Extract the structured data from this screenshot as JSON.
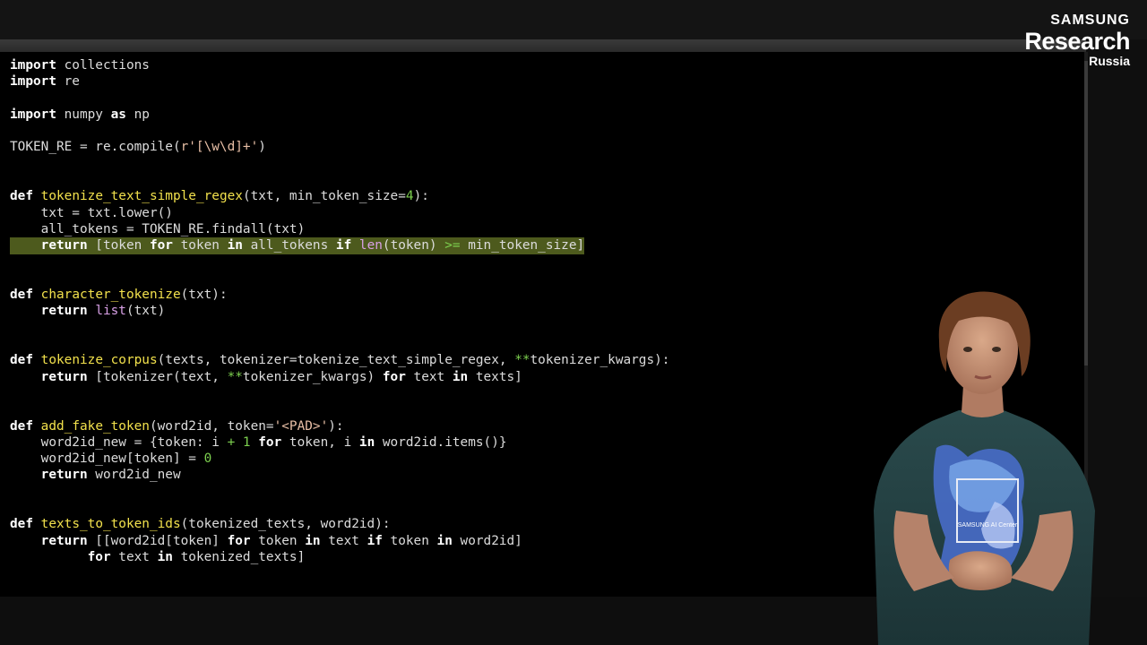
{
  "logo": {
    "line1": "SAMSUNG",
    "line2": "Research",
    "line3": "Russia"
  },
  "shirt_text": "SAMSUNG AI Center",
  "code": {
    "l1": {
      "kw": "import",
      "rest": " collections"
    },
    "l2": {
      "kw": "import",
      "rest": " re"
    },
    "l4": {
      "kw1": "import",
      "mid": " numpy ",
      "kw2": "as",
      "rest": " np"
    },
    "l6": {
      "a": "TOKEN_RE = re.compile(",
      "str": "r'[\\w\\d]+'",
      "b": ")"
    },
    "l9": {
      "kw": "def",
      "fn": "tokenize_text_simple_regex",
      "a": "(txt, min_token_size=",
      "num": "4",
      "b": "):"
    },
    "l10": {
      "a": "    txt = txt.lower()"
    },
    "l11": {
      "a": "    all_tokens = TOKEN_RE.findall(txt)"
    },
    "l12": {
      "kw1": "return",
      "a": " [token ",
      "kw2": "for",
      "b": " token ",
      "kw3": "in",
      "c": " all_tokens ",
      "kw4": "if",
      "sp": " ",
      "bi": "len",
      "d": "(token) ",
      "op": ">=",
      "e": " min_token_size]"
    },
    "l15": {
      "kw": "def",
      "fn": "character_tokenize",
      "a": "(txt):"
    },
    "l16": {
      "kw": "return",
      "sp": " ",
      "bi": "list",
      "a": "(txt)"
    },
    "l19": {
      "kw": "def",
      "fn": "tokenize_corpus",
      "a": "(texts, tokenizer=tokenize_text_simple_regex, ",
      "op": "**",
      "b": "tokenizer_kwargs):"
    },
    "l20": {
      "kw1": "return",
      "a": " [tokenizer(text, ",
      "op": "**",
      "b": "tokenizer_kwargs) ",
      "kw2": "for",
      "c": " text ",
      "kw3": "in",
      "d": " texts]"
    },
    "l23": {
      "kw": "def",
      "fn": "add_fake_token",
      "a": "(word2id, token=",
      "str": "'<PAD>'",
      "b": "):"
    },
    "l24": {
      "a": "    word2id_new = {token: i ",
      "op": "+",
      "num": " 1 ",
      "kw1": "for",
      "b": " token, i ",
      "kw2": "in",
      "c": " word2id.items()}"
    },
    "l25": {
      "a": "    word2id_new[token] = ",
      "num": "0"
    },
    "l26": {
      "kw": "return",
      "a": " word2id_new"
    },
    "l29": {
      "kw": "def",
      "fn": "texts_to_token_ids",
      "a": "(tokenized_texts, word2id):"
    },
    "l30": {
      "kw1": "return",
      "a": " [[word2id[token] ",
      "kw2": "for",
      "b": " token ",
      "kw3": "in",
      "c": " text ",
      "kw4": "if",
      "d": " token ",
      "kw5": "in",
      "e": " word2id]"
    },
    "l31": {
      "kw1": "for",
      "a": " text ",
      "kw2": "in",
      "b": " tokenized_texts]"
    }
  }
}
